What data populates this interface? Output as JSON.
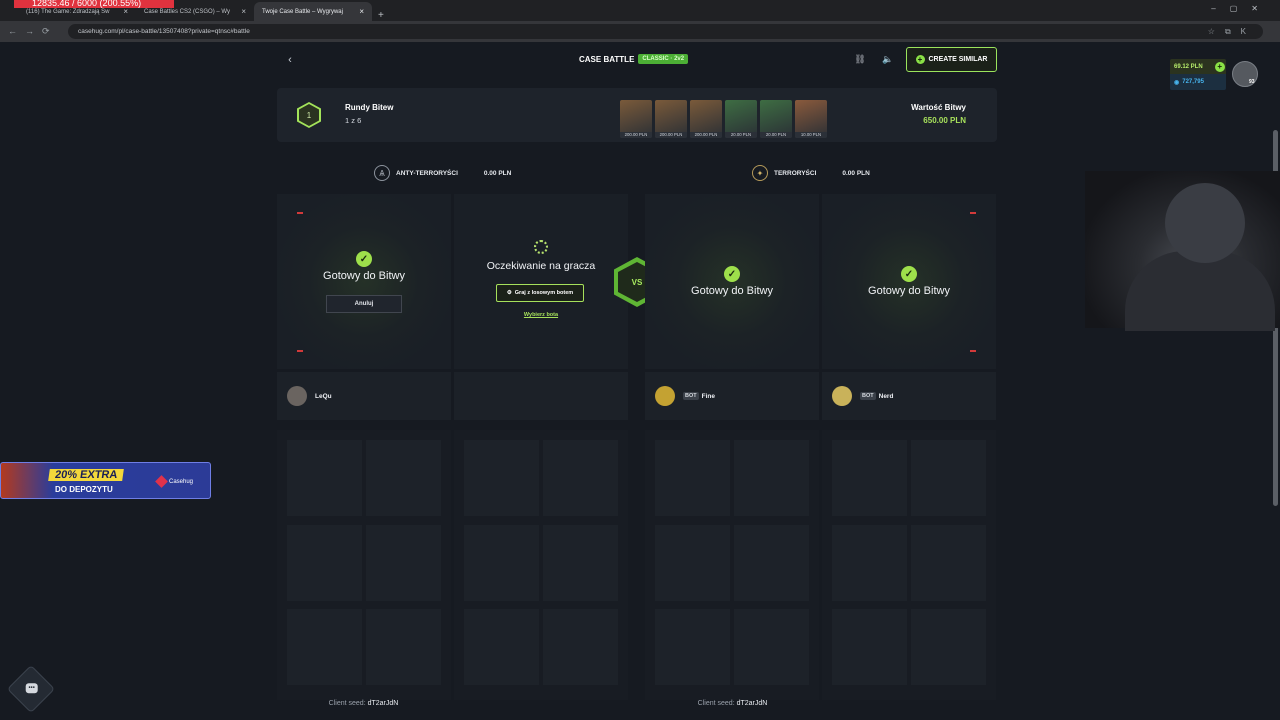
{
  "browser": {
    "tabs": [
      {
        "label": "(116) The Game: Zdradzają Sw",
        "active": false
      },
      {
        "label": "Case Battles CS2 (CSGO) – Wy",
        "active": false
      },
      {
        "label": "Twoje Case Battle – Wygrywaj",
        "active": true
      }
    ],
    "overlay_text": "12835.46 / 6000 (200.55%)",
    "url": "casehug.com/pl/case-battle/13507408?private=qtnsc#battle"
  },
  "header": {
    "title": "CASE BATTLE",
    "mode_badge": "CLASSIC · 2v2",
    "create_similar_label": "CREATE SIMILAR"
  },
  "info": {
    "round_number": "1",
    "rounds_label": "Rundy Bitew",
    "rounds_value": "1 z 6",
    "value_label": "Wartość Bitwy",
    "value_amount": "650.00 PLN",
    "cases": [
      {
        "price": "200.00 PLN",
        "color": "#7a5a3a"
      },
      {
        "price": "200.00 PLN",
        "color": "#7a5a3a"
      },
      {
        "price": "200.00 PLN",
        "color": "#7a5a3a"
      },
      {
        "price": "20.00 PLN",
        "color": "#3e6d43"
      },
      {
        "price": "20.00 PLN",
        "color": "#3e6d43"
      },
      {
        "price": "10.00 PLN",
        "color": "#8a5a3c"
      }
    ]
  },
  "teams": {
    "ct": {
      "name": "ANTY-TERRORYŚCI",
      "total": "0.00 PLN"
    },
    "t": {
      "name": "TERRORYŚCI",
      "total": "0.00 PLN"
    }
  },
  "slots": {
    "ready_text": "Gotowy do Bitwy",
    "cancel_label": "Anuluj",
    "waiting_text": "Oczekiwanie na gracza",
    "bot_button_label": "Graj z losowym botem",
    "choose_bot_label": "Wybierz bota",
    "vs_label": "VS"
  },
  "players": [
    {
      "name": "LeQu",
      "bot": ""
    },
    {
      "name": "",
      "bot": ""
    },
    {
      "name": "Fine",
      "bot": "BOT"
    },
    {
      "name": "Nerd",
      "bot": "BOT"
    }
  ],
  "seeds": {
    "label": "Client seed:",
    "left": "dT2arJdN",
    "right": "dT2arJdN"
  },
  "wallet": {
    "balance": "69.12 PLN",
    "coins": "727,795",
    "level": "93"
  },
  "promo": {
    "extra": "20% EXTRA",
    "deposit": "DO DEPOZYTU",
    "brand": "Casehug"
  },
  "colors": {
    "accent": "#a6e05b",
    "background": "#161a21",
    "panel": "#1e232b",
    "danger": "#d23a3a"
  }
}
